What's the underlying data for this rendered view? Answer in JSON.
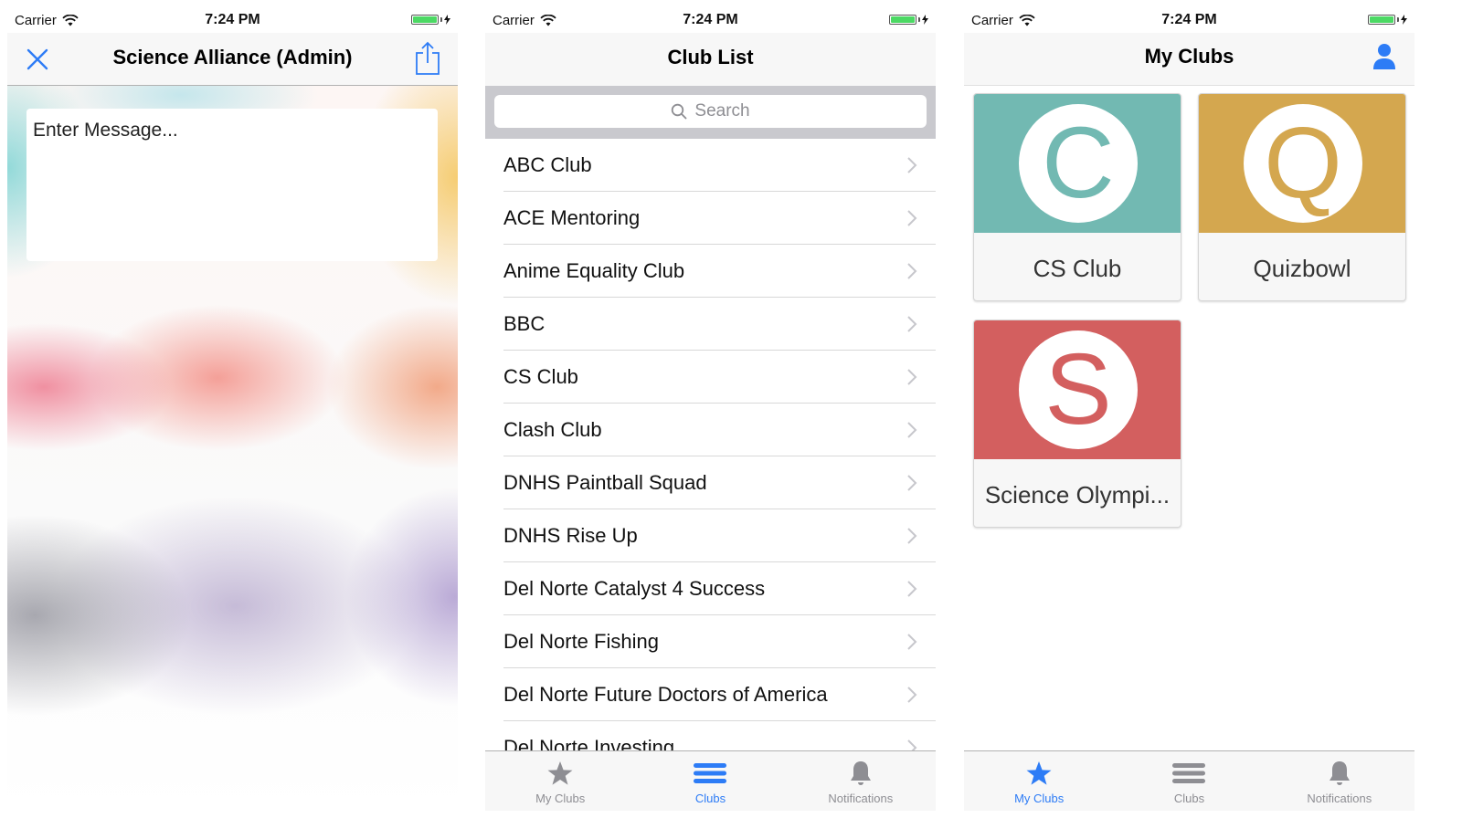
{
  "screens": {
    "compose": {
      "status": {
        "carrier": "Carrier",
        "time": "7:24 PM"
      },
      "nav_title": "Science Alliance (Admin)",
      "message_placeholder": "Enter Message..."
    },
    "club_list": {
      "status": {
        "carrier": "Carrier",
        "time": "7:24 PM"
      },
      "nav_title": "Club List",
      "search_placeholder": "Search",
      "clubs": [
        "ABC Club",
        "ACE Mentoring",
        "Anime Equality Club",
        "BBC",
        "CS Club",
        "Clash Club",
        "DNHS Paintball Squad",
        "DNHS Rise Up",
        "Del Norte Catalyst 4 Success",
        "Del Norte Fishing",
        "Del Norte Future Doctors of America",
        "Del Norte Investing"
      ],
      "tabs": [
        {
          "label": "My Clubs",
          "icon": "star-icon",
          "active": false
        },
        {
          "label": "Clubs",
          "icon": "list-icon",
          "active": true
        },
        {
          "label": "Notifications",
          "icon": "bell-icon",
          "active": false
        }
      ]
    },
    "my_clubs": {
      "status": {
        "carrier": "Carrier",
        "time": "7:24 PM"
      },
      "nav_title": "My Clubs",
      "cards": [
        {
          "letter": "C",
          "name": "CS Club",
          "color": "#72b9b2"
        },
        {
          "letter": "Q",
          "name": "Quizbowl",
          "color": "#d4a74f"
        },
        {
          "letter": "S",
          "name": "Science Olympi...",
          "color": "#d35f5f"
        }
      ],
      "tabs": [
        {
          "label": "My Clubs",
          "icon": "star-icon",
          "active": true
        },
        {
          "label": "Clubs",
          "icon": "list-icon",
          "active": false
        },
        {
          "label": "Notifications",
          "icon": "bell-icon",
          "active": false
        }
      ]
    }
  },
  "colors": {
    "accent": "#2d7cf6",
    "tab_inactive": "#8e8e93",
    "battery": "#4cd964"
  }
}
